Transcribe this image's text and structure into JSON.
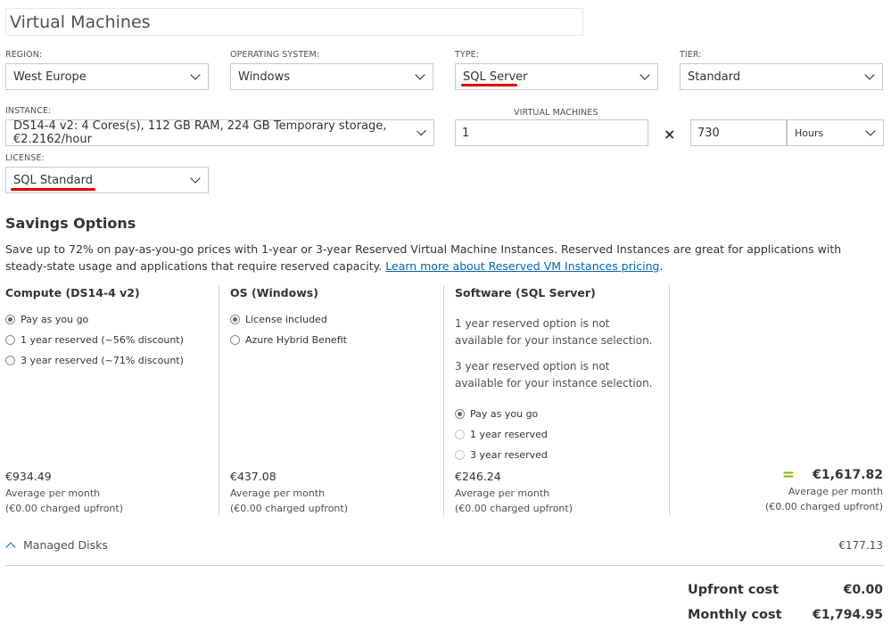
{
  "title": "Virtual Machines",
  "filters": {
    "region": {
      "label": "REGION:",
      "value": "West Europe"
    },
    "os": {
      "label": "OPERATING SYSTEM:",
      "value": "Windows"
    },
    "type": {
      "label": "TYPE:",
      "value": "SQL Server"
    },
    "tier": {
      "label": "TIER:",
      "value": "Standard"
    },
    "instance": {
      "label": "INSTANCE:",
      "value": "DS14-4 v2: 4 Cores(s), 112 GB RAM, 224 GB Temporary storage, €2.2162/hour"
    },
    "vms": {
      "label": "VIRTUAL MACHINES",
      "value": "1"
    },
    "multiply": "×",
    "hours_value": "730",
    "hours_unit": "Hours",
    "license": {
      "label": "LICENSE:",
      "value": "SQL Standard"
    }
  },
  "savings": {
    "heading": "Savings Options",
    "text": "Save up to 72% on pay-as-you-go prices with 1-year or 3-year Reserved Virtual Machine Instances. Reserved Instances are great for applications with steady-state usage and applications that require reserved capacity.",
    "link": "Learn more about Reserved VM Instances pricing",
    "period": "."
  },
  "columns": {
    "compute": {
      "heading": "Compute (DS14-4 v2)",
      "options": [
        "Pay as you go",
        "1 year reserved (~56% discount)",
        "3 year reserved (~71% discount)"
      ],
      "price": "€934.49",
      "avg": "Average per month",
      "upfront": "(€0.00 charged upfront)"
    },
    "os": {
      "heading": "OS (Windows)",
      "options": [
        "License included",
        "Azure Hybrid Benefit"
      ],
      "price": "€437.08",
      "avg": "Average per month",
      "upfront": "(€0.00 charged upfront)"
    },
    "software": {
      "heading": "Software (SQL Server)",
      "note1": "1 year reserved option is not available for your instance selection.",
      "note2": "3 year reserved option is not available for your instance selection.",
      "options": [
        "Pay as you go",
        "1 year reserved",
        "3 year reserved"
      ],
      "price": "€246.24",
      "avg": "Average per month",
      "upfront": "(€0.00 charged upfront)"
    },
    "total": {
      "equals": "=",
      "price": "€1,617.82",
      "avg": "Average per month",
      "upfront": "(€0.00 charged upfront)"
    }
  },
  "disks": {
    "label": "Managed Disks",
    "price": "€177.13"
  },
  "summary": {
    "upfront_label": "Upfront cost",
    "upfront_value": "€0.00",
    "monthly_label": "Monthly cost",
    "monthly_value": "€1,794.95"
  },
  "colors": {
    "accent_green": "#7fba00",
    "link": "#0066b8",
    "underline_red": "#e00000"
  }
}
